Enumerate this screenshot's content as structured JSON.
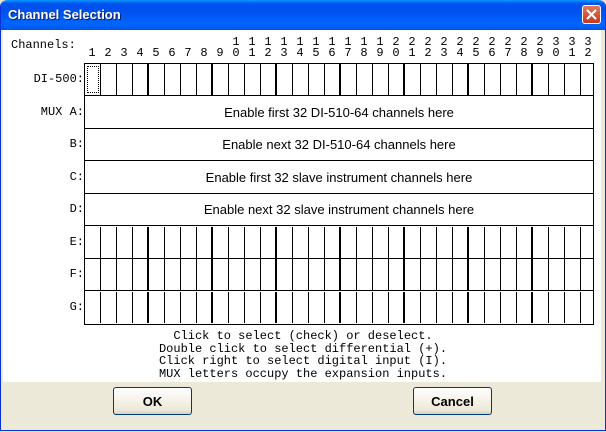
{
  "window": {
    "title": "Channel Selection"
  },
  "grid": {
    "channels_label": "Channels:",
    "column_numbers": [
      "1",
      "2",
      "3",
      "4",
      "5",
      "6",
      "7",
      "8",
      "9",
      "1\n0",
      "1\n1",
      "1\n2",
      "1\n3",
      "1\n4",
      "1\n5",
      "1\n6",
      "1\n7",
      "1\n8",
      "1\n9",
      "2\n0",
      "2\n1",
      "2\n2",
      "2\n3",
      "2\n4",
      "2\n5",
      "2\n6",
      "2\n7",
      "2\n8",
      "2\n9",
      "3\n0",
      "3\n1",
      "3\n2"
    ],
    "rows": [
      {
        "label": "DI-500:",
        "text": ""
      },
      {
        "label": "MUX A:",
        "text": "Enable first 32 DI-510-64 channels here"
      },
      {
        "label": "B:",
        "text": "Enable next 32 DI-510-64 channels here"
      },
      {
        "label": "C:",
        "text": "Enable first 32 slave instrument channels here"
      },
      {
        "label": "D:",
        "text": "Enable next 32 slave instrument channels here"
      },
      {
        "label": "E:",
        "text": ""
      },
      {
        "label": "F:",
        "text": ""
      },
      {
        "label": "G:",
        "text": ""
      }
    ]
  },
  "help": [
    "Click to select (check) or deselect.",
    "Double click to select differential (+).",
    "Click right to select digital input (I).",
    "MUX letters occupy the expansion inputs."
  ],
  "buttons": {
    "ok": "OK",
    "cancel": "Cancel"
  }
}
